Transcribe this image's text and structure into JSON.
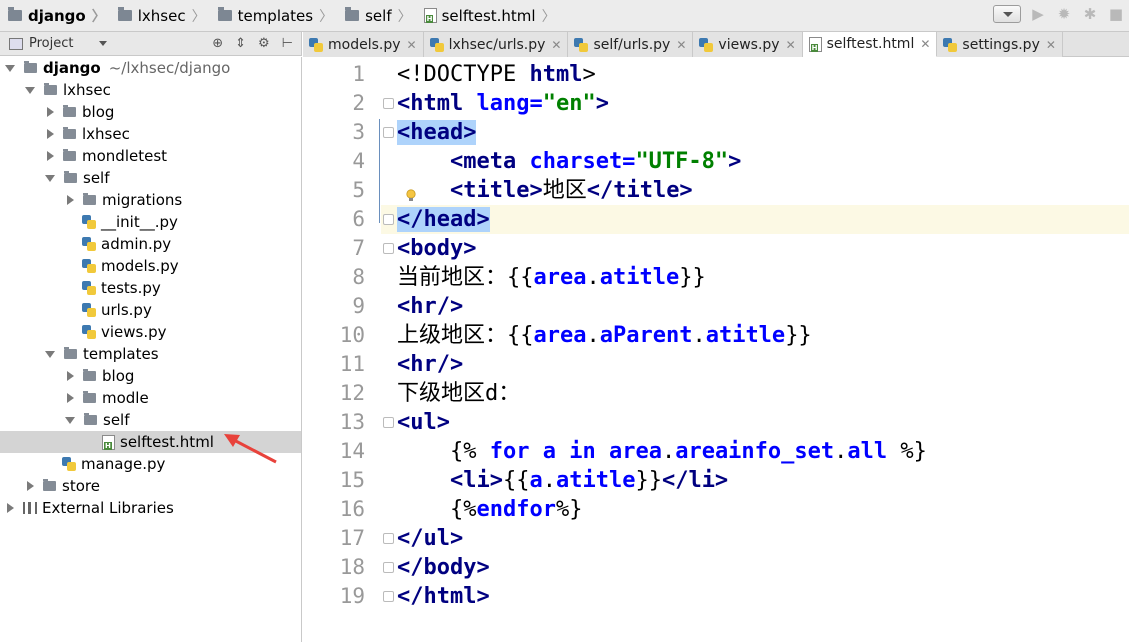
{
  "breadcrumbs": [
    "django",
    "lxhsec",
    "templates",
    "self",
    "selftest.html"
  ],
  "project_panel": {
    "title": "Project"
  },
  "tree": [
    {
      "label": "django",
      "extra": "~/lxhsec/django",
      "depth": 0,
      "type": "folder",
      "state": "open",
      "bold": true
    },
    {
      "label": "lxhsec",
      "depth": 1,
      "type": "folder",
      "state": "open"
    },
    {
      "label": "blog",
      "depth": 2,
      "type": "folder",
      "state": "closed"
    },
    {
      "label": "lxhsec",
      "depth": 2,
      "type": "folder",
      "state": "closed"
    },
    {
      "label": "mondletest",
      "depth": 2,
      "type": "folder",
      "state": "closed"
    },
    {
      "label": "self",
      "depth": 2,
      "type": "folder",
      "state": "open"
    },
    {
      "label": "migrations",
      "depth": 3,
      "type": "folder",
      "state": "closed"
    },
    {
      "label": "__init__.py",
      "depth": 3,
      "type": "py"
    },
    {
      "label": "admin.py",
      "depth": 3,
      "type": "py"
    },
    {
      "label": "models.py",
      "depth": 3,
      "type": "py"
    },
    {
      "label": "tests.py",
      "depth": 3,
      "type": "py"
    },
    {
      "label": "urls.py",
      "depth": 3,
      "type": "py"
    },
    {
      "label": "views.py",
      "depth": 3,
      "type": "py"
    },
    {
      "label": "templates",
      "depth": 2,
      "type": "folder",
      "state": "open"
    },
    {
      "label": "blog",
      "depth": 3,
      "type": "folder",
      "state": "closed"
    },
    {
      "label": "modle",
      "depth": 3,
      "type": "folder",
      "state": "closed"
    },
    {
      "label": "self",
      "depth": 3,
      "type": "folder",
      "state": "open"
    },
    {
      "label": "selftest.html",
      "depth": 4,
      "type": "html",
      "selected": true
    },
    {
      "label": "manage.py",
      "depth": 2,
      "type": "py"
    },
    {
      "label": "store",
      "depth": 1,
      "type": "folder",
      "state": "closed"
    },
    {
      "label": "External Libraries",
      "depth": 0,
      "type": "lib",
      "state": "closed"
    }
  ],
  "tabs": [
    {
      "label": "models.py",
      "icon": "python-file-icon"
    },
    {
      "label": "lxhsec/urls.py",
      "icon": "python-file-icon"
    },
    {
      "label": "self/urls.py",
      "icon": "python-file-icon"
    },
    {
      "label": "views.py",
      "icon": "python-file-icon"
    },
    {
      "label": "selftest.html",
      "icon": "html-file-icon",
      "active": true
    },
    {
      "label": "settings.py",
      "icon": "python-file-icon"
    }
  ],
  "editor": {
    "current_line": 6,
    "lines": [
      [
        [
          "p",
          "<!DOCTYPE "
        ],
        [
          "t",
          "html"
        ],
        [
          "p",
          ">"
        ]
      ],
      [
        [
          "t",
          "<html "
        ],
        [
          "a",
          "lang="
        ],
        [
          "s",
          "\"en\""
        ],
        [
          "t",
          ">"
        ]
      ],
      [
        [
          "th",
          "<head>"
        ]
      ],
      [
        [
          "p",
          "    "
        ],
        [
          "t",
          "<meta "
        ],
        [
          "a",
          "charset="
        ],
        [
          "s",
          "\"UTF-8\""
        ],
        [
          "t",
          ">"
        ]
      ],
      [
        [
          "p",
          "    "
        ],
        [
          "t",
          "<title>"
        ],
        [
          "p",
          "地区"
        ],
        [
          "t",
          "</title>"
        ]
      ],
      [
        [
          "th",
          "</head>"
        ]
      ],
      [
        [
          "t",
          "<body>"
        ]
      ],
      [
        [
          "p",
          "当前地区：{{"
        ],
        [
          "v",
          "area"
        ],
        [
          "p",
          "."
        ],
        [
          "v",
          "atitle"
        ],
        [
          "p",
          "}}"
        ]
      ],
      [
        [
          "t",
          "<hr/>"
        ]
      ],
      [
        [
          "p",
          "上级地区：{{"
        ],
        [
          "v",
          "area"
        ],
        [
          "p",
          "."
        ],
        [
          "v",
          "aParent"
        ],
        [
          "p",
          "."
        ],
        [
          "v",
          "atitle"
        ],
        [
          "p",
          "}}"
        ]
      ],
      [
        [
          "t",
          "<hr/>"
        ]
      ],
      [
        [
          "p",
          "下级地区d："
        ]
      ],
      [
        [
          "t",
          "<ul>"
        ]
      ],
      [
        [
          "p",
          "    {% "
        ],
        [
          "v",
          "for"
        ],
        [
          "p",
          " "
        ],
        [
          "v",
          "a"
        ],
        [
          "p",
          " "
        ],
        [
          "v",
          "in"
        ],
        [
          "p",
          " "
        ],
        [
          "v",
          "area"
        ],
        [
          "p",
          "."
        ],
        [
          "v",
          "areainfo_set"
        ],
        [
          "p",
          "."
        ],
        [
          "v",
          "all"
        ],
        [
          "p",
          " %}"
        ]
      ],
      [
        [
          "p",
          "    "
        ],
        [
          "t",
          "<li>"
        ],
        [
          "p",
          "{{"
        ],
        [
          "v",
          "a"
        ],
        [
          "p",
          "."
        ],
        [
          "v",
          "atitle"
        ],
        [
          "p",
          "}}"
        ],
        [
          "t",
          "</li>"
        ]
      ],
      [
        [
          "p",
          "    {%"
        ],
        [
          "v",
          "endfor"
        ],
        [
          "p",
          "%}"
        ]
      ],
      [
        [
          "t",
          "</ul>"
        ]
      ],
      [
        [
          "t",
          "</body>"
        ]
      ],
      [
        [
          "t",
          "</html>"
        ]
      ]
    ]
  },
  "colors": {
    "tag": "#000080",
    "attr": "#0000ff",
    "string": "#008000",
    "template_var": "#0000ff",
    "highlight": "#aed3fb",
    "current_line": "#fcf9e4",
    "selection": "#d4d4d4",
    "arrow": "#e8423b"
  }
}
